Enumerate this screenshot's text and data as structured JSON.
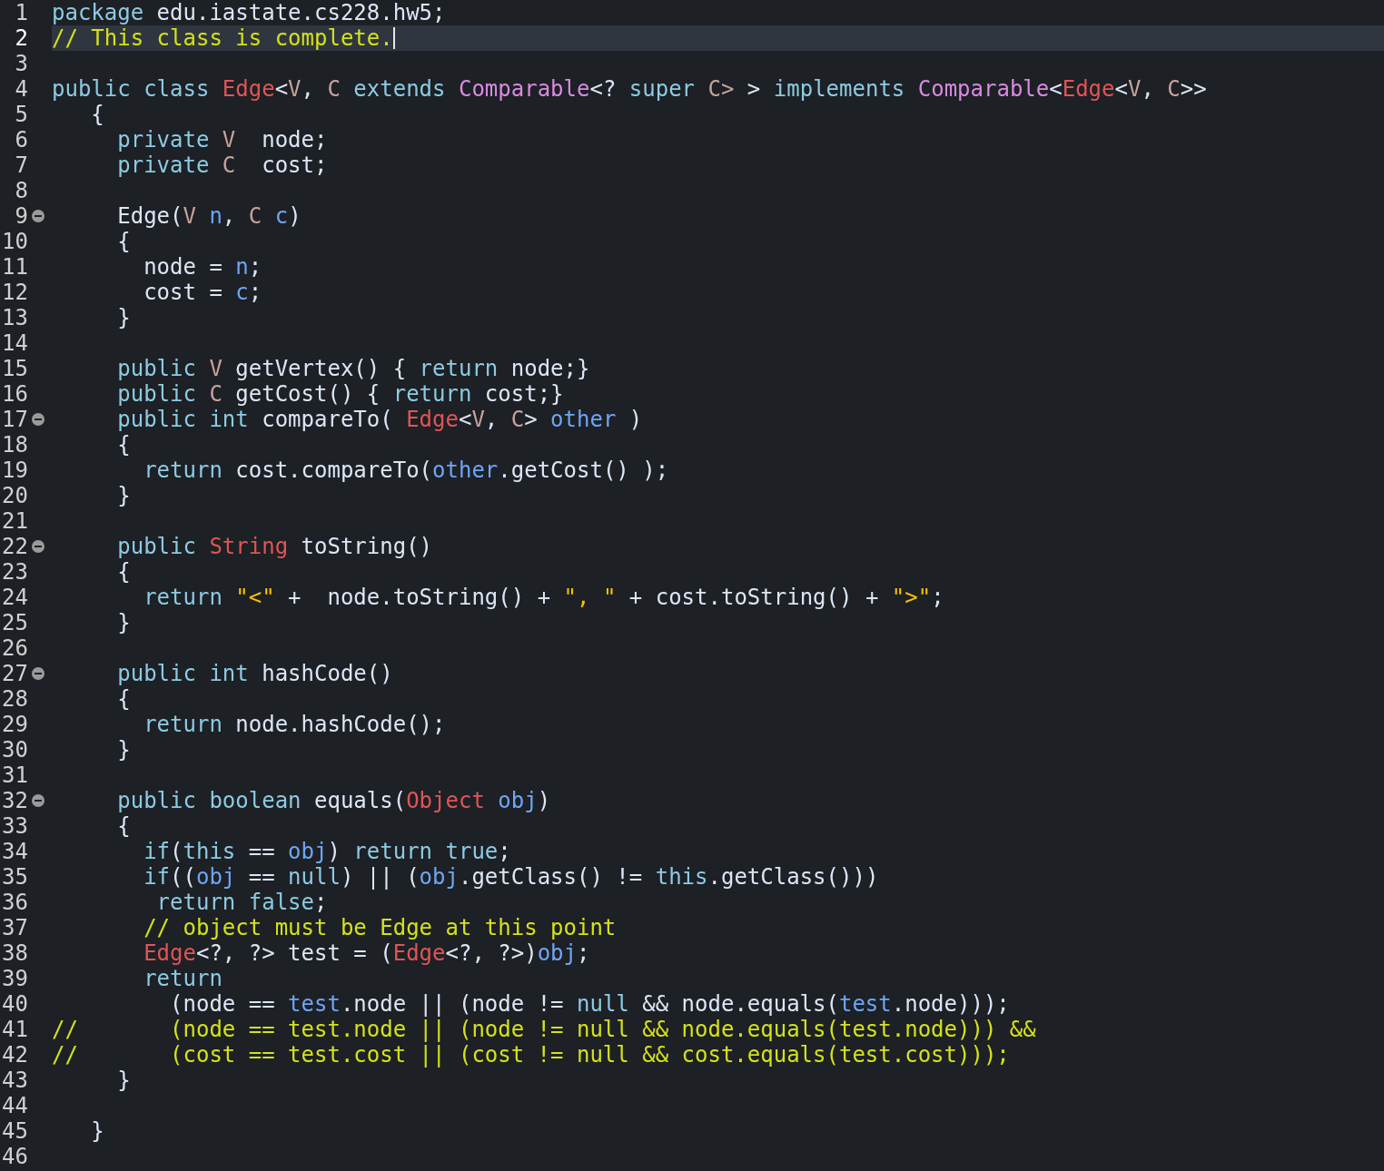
{
  "editor": {
    "lines": [
      {
        "number": "1",
        "foldable": false,
        "current": false,
        "tokens": [
          {
            "kind": "keyword",
            "text": "package"
          },
          {
            "kind": "ident",
            "text": " edu.iastate.cs228.hw5;"
          }
        ]
      },
      {
        "number": "2",
        "foldable": false,
        "current": true,
        "tokens": [
          {
            "kind": "comment",
            "text": "// This class is complete."
          }
        ]
      },
      {
        "number": "3",
        "foldable": false,
        "current": false
      },
      {
        "number": "4",
        "foldable": false,
        "current": false,
        "tokens": [
          {
            "kind": "keyword",
            "text": "public class "
          },
          {
            "kind": "type",
            "text": "Edge"
          },
          {
            "kind": "ident",
            "text": "<"
          },
          {
            "kind": "tparam",
            "text": "V"
          },
          {
            "kind": "ident",
            "text": ", "
          },
          {
            "kind": "tparam",
            "text": "C"
          },
          {
            "kind": "keyword",
            "text": " extends "
          },
          {
            "kind": "iface",
            "text": "Comparable"
          },
          {
            "kind": "ident",
            "text": "<? "
          },
          {
            "kind": "keyword",
            "text": "super"
          },
          {
            "kind": "tparam",
            "text": " C>"
          },
          {
            "kind": "ident",
            "text": " > "
          },
          {
            "kind": "keyword",
            "text": "implements "
          },
          {
            "kind": "iface",
            "text": "Comparable"
          },
          {
            "kind": "ident",
            "text": "<"
          },
          {
            "kind": "type",
            "text": "Edge"
          },
          {
            "kind": "ident",
            "text": "<"
          },
          {
            "kind": "tparam",
            "text": "V"
          },
          {
            "kind": "ident",
            "text": ", "
          },
          {
            "kind": "tparam",
            "text": "C"
          },
          {
            "kind": "ident",
            "text": ">>"
          }
        ]
      },
      {
        "number": "5",
        "foldable": false,
        "current": false,
        "tokens": [
          {
            "kind": "ident",
            "text": "   {"
          }
        ]
      },
      {
        "number": "6",
        "foldable": false,
        "current": false,
        "tokens": [
          {
            "kind": "keyword",
            "text": "     private "
          },
          {
            "kind": "tparam",
            "text": "V"
          },
          {
            "kind": "ident",
            "text": "  node;"
          }
        ]
      },
      {
        "number": "7",
        "foldable": false,
        "current": false,
        "tokens": [
          {
            "kind": "keyword",
            "text": "     private "
          },
          {
            "kind": "tparam",
            "text": "C"
          },
          {
            "kind": "ident",
            "text": "  cost;"
          }
        ]
      },
      {
        "number": "8",
        "foldable": false,
        "current": false
      },
      {
        "number": "9",
        "foldable": true,
        "current": false,
        "tokens": [
          {
            "kind": "ident",
            "text": "     Edge("
          },
          {
            "kind": "tparam",
            "text": "V"
          },
          {
            "kind": "param",
            "text": " n"
          },
          {
            "kind": "ident",
            "text": ", "
          },
          {
            "kind": "tparam",
            "text": "C"
          },
          {
            "kind": "param",
            "text": " c"
          },
          {
            "kind": "ident",
            "text": ")"
          }
        ]
      },
      {
        "number": "10",
        "foldable": false,
        "current": false,
        "tokens": [
          {
            "kind": "ident",
            "text": "     {"
          }
        ]
      },
      {
        "number": "11",
        "foldable": false,
        "current": false,
        "tokens": [
          {
            "kind": "ident",
            "text": "       node = "
          },
          {
            "kind": "param",
            "text": "n"
          },
          {
            "kind": "ident",
            "text": ";"
          }
        ]
      },
      {
        "number": "12",
        "foldable": false,
        "current": false,
        "tokens": [
          {
            "kind": "ident",
            "text": "       cost = "
          },
          {
            "kind": "param",
            "text": "c"
          },
          {
            "kind": "ident",
            "text": ";"
          }
        ]
      },
      {
        "number": "13",
        "foldable": false,
        "current": false,
        "tokens": [
          {
            "kind": "ident",
            "text": "     }"
          }
        ]
      },
      {
        "number": "14",
        "foldable": false,
        "current": false
      },
      {
        "number": "15",
        "foldable": false,
        "current": false,
        "tokens": [
          {
            "kind": "keyword",
            "text": "     public "
          },
          {
            "kind": "tparam",
            "text": "V"
          },
          {
            "kind": "ident",
            "text": " getVertex() { "
          },
          {
            "kind": "keyword",
            "text": "return"
          },
          {
            "kind": "ident",
            "text": " node;}"
          }
        ]
      },
      {
        "number": "16",
        "foldable": false,
        "current": false,
        "tokens": [
          {
            "kind": "keyword",
            "text": "     public "
          },
          {
            "kind": "tparam",
            "text": "C"
          },
          {
            "kind": "ident",
            "text": " getCost() { "
          },
          {
            "kind": "keyword",
            "text": "return"
          },
          {
            "kind": "ident",
            "text": " cost;}"
          }
        ]
      },
      {
        "number": "17",
        "foldable": true,
        "current": false,
        "tokens": [
          {
            "kind": "keyword",
            "text": "     public int "
          },
          {
            "kind": "ident",
            "text": "compareTo( "
          },
          {
            "kind": "type",
            "text": "Edge"
          },
          {
            "kind": "ident",
            "text": "<"
          },
          {
            "kind": "tparam",
            "text": "V"
          },
          {
            "kind": "ident",
            "text": ", "
          },
          {
            "kind": "tparam",
            "text": "C"
          },
          {
            "kind": "ident",
            "text": "> "
          },
          {
            "kind": "param",
            "text": "other"
          },
          {
            "kind": "ident",
            "text": " )"
          }
        ]
      },
      {
        "number": "18",
        "foldable": false,
        "current": false,
        "tokens": [
          {
            "kind": "ident",
            "text": "     {"
          }
        ]
      },
      {
        "number": "19",
        "foldable": false,
        "current": false,
        "tokens": [
          {
            "kind": "keyword",
            "text": "       return "
          },
          {
            "kind": "ident",
            "text": "cost.compareTo("
          },
          {
            "kind": "param",
            "text": "other"
          },
          {
            "kind": "ident",
            "text": ".getCost() );"
          }
        ]
      },
      {
        "number": "20",
        "foldable": false,
        "current": false,
        "tokens": [
          {
            "kind": "ident",
            "text": "     }"
          }
        ]
      },
      {
        "number": "21",
        "foldable": false,
        "current": false
      },
      {
        "number": "22",
        "foldable": true,
        "current": false,
        "tokens": [
          {
            "kind": "keyword",
            "text": "     public "
          },
          {
            "kind": "type",
            "text": "String"
          },
          {
            "kind": "ident",
            "text": " toString()"
          }
        ]
      },
      {
        "number": "23",
        "foldable": false,
        "current": false,
        "tokens": [
          {
            "kind": "ident",
            "text": "     {"
          }
        ]
      },
      {
        "number": "24",
        "foldable": false,
        "current": false,
        "tokens": [
          {
            "kind": "keyword",
            "text": "       return "
          },
          {
            "kind": "string",
            "text": "\"<\""
          },
          {
            "kind": "ident",
            "text": " +  node.toString() + "
          },
          {
            "kind": "string",
            "text": "\", \""
          },
          {
            "kind": "ident",
            "text": " + cost.toString() + "
          },
          {
            "kind": "string",
            "text": "\">\""
          },
          {
            "kind": "ident",
            "text": ";"
          }
        ]
      },
      {
        "number": "25",
        "foldable": false,
        "current": false,
        "tokens": [
          {
            "kind": "ident",
            "text": "     }"
          }
        ]
      },
      {
        "number": "26",
        "foldable": false,
        "current": false
      },
      {
        "number": "27",
        "foldable": true,
        "current": false,
        "tokens": [
          {
            "kind": "keyword",
            "text": "     public int "
          },
          {
            "kind": "ident",
            "text": "hashCode()"
          }
        ]
      },
      {
        "number": "28",
        "foldable": false,
        "current": false,
        "tokens": [
          {
            "kind": "ident",
            "text": "     {"
          }
        ]
      },
      {
        "number": "29",
        "foldable": false,
        "current": false,
        "tokens": [
          {
            "kind": "keyword",
            "text": "       return "
          },
          {
            "kind": "ident",
            "text": "node.hashCode();"
          }
        ]
      },
      {
        "number": "30",
        "foldable": false,
        "current": false,
        "tokens": [
          {
            "kind": "ident",
            "text": "     }"
          }
        ]
      },
      {
        "number": "31",
        "foldable": false,
        "current": false
      },
      {
        "number": "32",
        "foldable": true,
        "current": false,
        "tokens": [
          {
            "kind": "keyword",
            "text": "     public boolean "
          },
          {
            "kind": "ident",
            "text": "equals("
          },
          {
            "kind": "type",
            "text": "Object"
          },
          {
            "kind": "param",
            "text": " obj"
          },
          {
            "kind": "ident",
            "text": ")"
          }
        ]
      },
      {
        "number": "33",
        "foldable": false,
        "current": false,
        "tokens": [
          {
            "kind": "ident",
            "text": "     {"
          }
        ]
      },
      {
        "number": "34",
        "foldable": false,
        "current": false,
        "tokens": [
          {
            "kind": "keyword",
            "text": "       if"
          },
          {
            "kind": "ident",
            "text": "("
          },
          {
            "kind": "keyword",
            "text": "this"
          },
          {
            "kind": "ident",
            "text": " == "
          },
          {
            "kind": "param",
            "text": "obj"
          },
          {
            "kind": "ident",
            "text": ") "
          },
          {
            "kind": "keyword",
            "text": "return true"
          },
          {
            "kind": "ident",
            "text": ";"
          }
        ]
      },
      {
        "number": "35",
        "foldable": false,
        "current": false,
        "tokens": [
          {
            "kind": "keyword",
            "text": "       if"
          },
          {
            "kind": "ident",
            "text": "(("
          },
          {
            "kind": "param",
            "text": "obj"
          },
          {
            "kind": "ident",
            "text": " == "
          },
          {
            "kind": "keyword",
            "text": "null"
          },
          {
            "kind": "ident",
            "text": ") || ("
          },
          {
            "kind": "param",
            "text": "obj"
          },
          {
            "kind": "ident",
            "text": ".getClass() != "
          },
          {
            "kind": "keyword",
            "text": "this"
          },
          {
            "kind": "ident",
            "text": ".getClass()))"
          }
        ]
      },
      {
        "number": "36",
        "foldable": false,
        "current": false,
        "tokens": [
          {
            "kind": "keyword",
            "text": "        return false"
          },
          {
            "kind": "ident",
            "text": ";"
          }
        ]
      },
      {
        "number": "37",
        "foldable": false,
        "current": false,
        "tokens": [
          {
            "kind": "comment",
            "text": "       // object must be Edge at this point"
          }
        ]
      },
      {
        "number": "38",
        "foldable": false,
        "current": false,
        "tokens": [
          {
            "kind": "type",
            "text": "       Edge"
          },
          {
            "kind": "ident",
            "text": "<?, ?> test = ("
          },
          {
            "kind": "type",
            "text": "Edge"
          },
          {
            "kind": "ident",
            "text": "<?, ?>)"
          },
          {
            "kind": "param",
            "text": "obj"
          },
          {
            "kind": "ident",
            "text": ";"
          }
        ]
      },
      {
        "number": "39",
        "foldable": false,
        "current": false,
        "tokens": [
          {
            "kind": "keyword",
            "text": "       return"
          }
        ]
      },
      {
        "number": "40",
        "foldable": false,
        "current": false,
        "tokens": [
          {
            "kind": "ident",
            "text": "         (node == "
          },
          {
            "kind": "param",
            "text": "test"
          },
          {
            "kind": "ident",
            "text": ".node || (node != "
          },
          {
            "kind": "keyword",
            "text": "null"
          },
          {
            "kind": "ident",
            "text": " && node.equals("
          },
          {
            "kind": "param",
            "text": "test"
          },
          {
            "kind": "ident",
            "text": ".node)));"
          }
        ]
      },
      {
        "number": "41",
        "foldable": false,
        "current": false,
        "tokens": [
          {
            "kind": "comment",
            "text": "//       (node == test.node || (node != null && node.equals(test.node))) &&"
          }
        ]
      },
      {
        "number": "42",
        "foldable": false,
        "current": false,
        "tokens": [
          {
            "kind": "comment",
            "text": "//       (cost == test.cost || (cost != null && cost.equals(test.cost)));"
          }
        ]
      },
      {
        "number": "43",
        "foldable": false,
        "current": false,
        "tokens": [
          {
            "kind": "ident",
            "text": "     }"
          }
        ]
      },
      {
        "number": "44",
        "foldable": false,
        "current": false
      },
      {
        "number": "45",
        "foldable": false,
        "current": false,
        "tokens": [
          {
            "kind": "ident",
            "text": "   }"
          }
        ]
      },
      {
        "number": "46",
        "foldable": false,
        "current": false
      }
    ]
  }
}
